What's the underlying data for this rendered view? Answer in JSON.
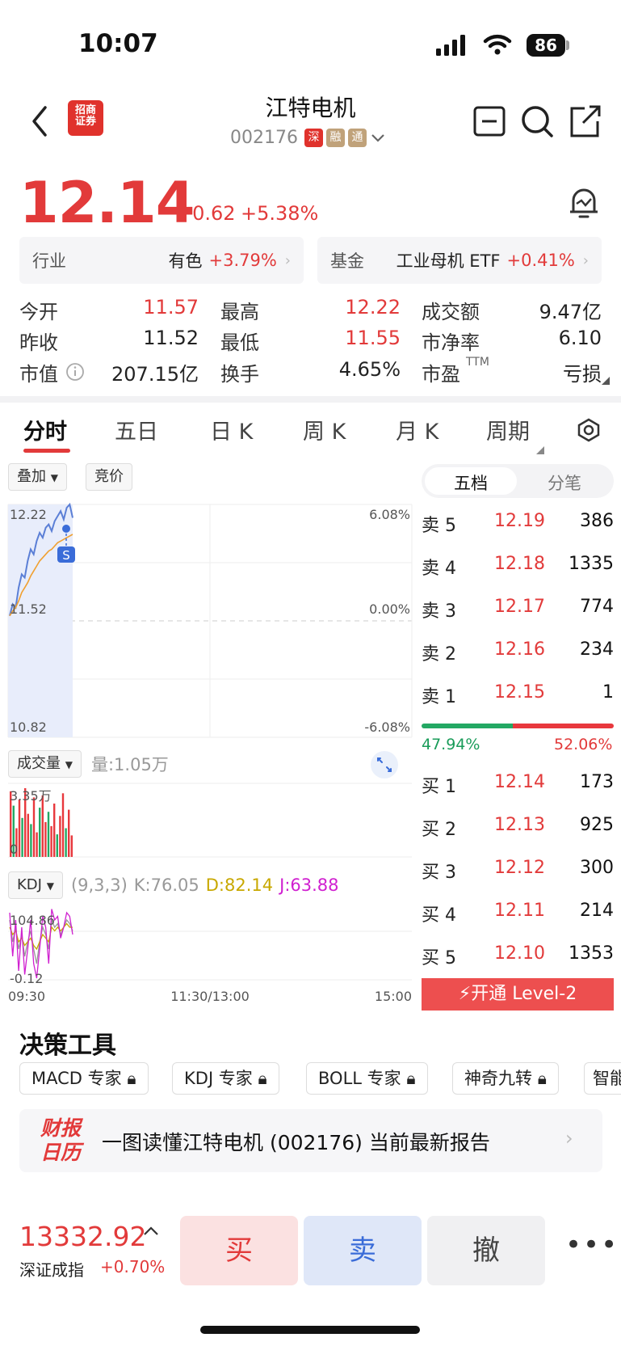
{
  "status_bar": {
    "time": "10:07",
    "battery": "86"
  },
  "header": {
    "broker_logo": "招商\n证券",
    "stock_name": "江特电机",
    "stock_code": "002176",
    "tags": [
      "深",
      "融",
      "通"
    ]
  },
  "quote": {
    "price": "12.14",
    "change": "+0.62",
    "change_pct": "+5.38%"
  },
  "industry": {
    "label": "行业",
    "name": "有色",
    "pct": "+3.79%"
  },
  "fund": {
    "label": "基金",
    "name": "工业母机 ETF",
    "pct": "+0.41%"
  },
  "stats": [
    [
      {
        "label": "今开",
        "value": "11.57",
        "color": "red"
      },
      {
        "label": "最高",
        "value": "12.22",
        "color": "red"
      },
      {
        "label": "成交额",
        "value": "9.47亿",
        "color": "black"
      }
    ],
    [
      {
        "label": "昨收",
        "value": "11.52",
        "color": "black"
      },
      {
        "label": "最低",
        "value": "11.55",
        "color": "red"
      },
      {
        "label": "市净率",
        "value": "6.10",
        "color": "black"
      }
    ],
    [
      {
        "label": "市值",
        "value": "207.15亿",
        "color": "black"
      },
      {
        "label": "换手",
        "value": "4.65%",
        "color": "black"
      },
      {
        "label": "市盈",
        "value": "亏损",
        "color": "black"
      }
    ]
  ],
  "pe_sup": "TTM",
  "period_tabs": [
    "分时",
    "五日",
    "日 K",
    "周 K",
    "月 K",
    "周期"
  ],
  "chart_controls": {
    "overlay": "叠加",
    "auction": "竞价"
  },
  "chart_data": {
    "type": "line",
    "price_axis": {
      "top": "12.22",
      "mid": "11.52",
      "bottom": "10.82"
    },
    "pct_axis": {
      "top": "6.08%",
      "mid": "0.00%",
      "bottom": "-6.08%"
    },
    "time_axis": [
      "09:30",
      "11:30/13:00",
      "15:00"
    ],
    "series": [
      {
        "color": "#5b7fd6",
        "values": [
          11.55,
          11.62,
          11.6,
          11.72,
          11.8,
          11.78,
          11.88,
          11.95,
          11.92,
          12.0,
          12.05,
          12.02,
          12.08,
          12.1,
          12.06,
          12.12,
          12.15,
          12.18,
          12.13,
          12.2,
          12.22,
          12.14
        ]
      },
      {
        "color": "#f0a030",
        "values": [
          11.55,
          11.58,
          11.6,
          11.64,
          11.69,
          11.72,
          11.75,
          11.79,
          11.82,
          11.85,
          11.88,
          11.9,
          11.92,
          11.94,
          11.95,
          11.97,
          11.99,
          12.0,
          12.01,
          12.02,
          12.03,
          12.04
        ]
      }
    ],
    "marker": "S",
    "volume": {
      "label": "成交量",
      "current": "量:1.05万",
      "max_label": "3.35万",
      "min_label": "0",
      "values": [
        3.2,
        2.5,
        1.4,
        2.8,
        1.9,
        3.35,
        2.1,
        1.6,
        2.9,
        1.2,
        2.4,
        3.0,
        1.7,
        2.2,
        1.5,
        2.6,
        1.1,
        2.0,
        3.1,
        1.4,
        2.3,
        1.05
      ]
    },
    "kdj": {
      "label": "KDJ",
      "params": "(9,3,3)",
      "k": "K:76.05",
      "d": "D:82.14",
      "j": "J:63.88",
      "max_label": "104.86",
      "min_label": "-0.12"
    }
  },
  "order_book": {
    "tabs": [
      "五档",
      "分笔"
    ],
    "asks": [
      {
        "side": "卖 5",
        "price": "12.19",
        "volume": "386"
      },
      {
        "side": "卖 4",
        "price": "12.18",
        "volume": "1335"
      },
      {
        "side": "卖 3",
        "price": "12.17",
        "volume": "774"
      },
      {
        "side": "卖 2",
        "price": "12.16",
        "volume": "234"
      },
      {
        "side": "卖 1",
        "price": "12.15",
        "volume": "1"
      }
    ],
    "buy_ratio": "47.94%",
    "sell_ratio": "52.06%",
    "bids": [
      {
        "side": "买 1",
        "price": "12.14",
        "volume": "173"
      },
      {
        "side": "买 2",
        "price": "12.13",
        "volume": "925"
      },
      {
        "side": "买 3",
        "price": "12.12",
        "volume": "300"
      },
      {
        "side": "买 4",
        "price": "12.11",
        "volume": "214"
      },
      {
        "side": "买 5",
        "price": "12.10",
        "volume": "1353"
      }
    ],
    "level2": "开通 Level-2"
  },
  "tools": {
    "title": "决策工具",
    "items": [
      "MACD 专家",
      "KDJ 专家",
      "BOLL 专家",
      "神奇九转",
      "智能"
    ]
  },
  "report": {
    "logo": "财报\n日历",
    "text": "一图读懂江特电机 (002176) 当前最新报告"
  },
  "bottom": {
    "index_value": "13332.92",
    "index_name": "深证成指",
    "index_pct": "+0.70%",
    "buy": "买",
    "sell": "卖",
    "cancel": "撤"
  },
  "colors": {
    "up": "#e23a3a",
    "down": "#1a9c5a",
    "accent": "#e23a3a"
  }
}
